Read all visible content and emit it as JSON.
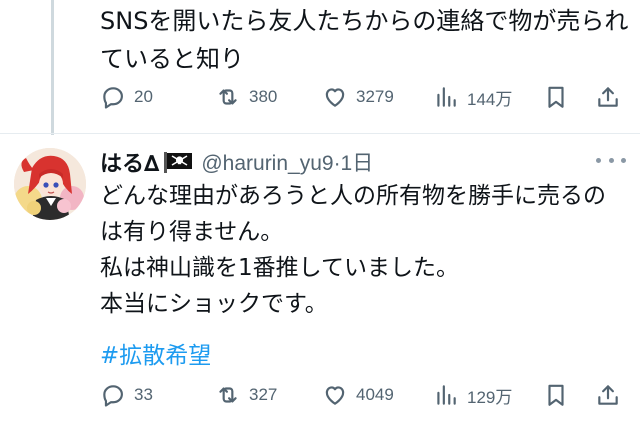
{
  "previous_tweet": {
    "text_lines": [
      "SNSを開いたら友人たちからの連絡で物が売られ",
      "ていると知り"
    ],
    "actions": {
      "replies": "20",
      "retweets": "380",
      "likes": "3279",
      "views": "144万"
    }
  },
  "tweet": {
    "display_name": "はる∆",
    "handle_time": "@harurin_yu9·1日",
    "text_lines": [
      "どんな理由があろうと人の所有物を勝手に売るの",
      "は有り得ません。",
      "私は神山識を1番推していました。",
      "本当にショックです。"
    ],
    "hashtag": "#拡散希望",
    "actions": {
      "replies": "33",
      "retweets": "327",
      "likes": "4049",
      "views": "129万"
    }
  },
  "colors": {
    "text": "#0f1419",
    "secondary": "#536471",
    "link": "#1d9bf0",
    "thread_line": "#cfd9de"
  },
  "icons": [
    "reply-icon",
    "retweet-icon",
    "like-icon",
    "views-icon",
    "bookmark-icon",
    "share-icon",
    "more-icon",
    "pirate-flag-icon"
  ]
}
